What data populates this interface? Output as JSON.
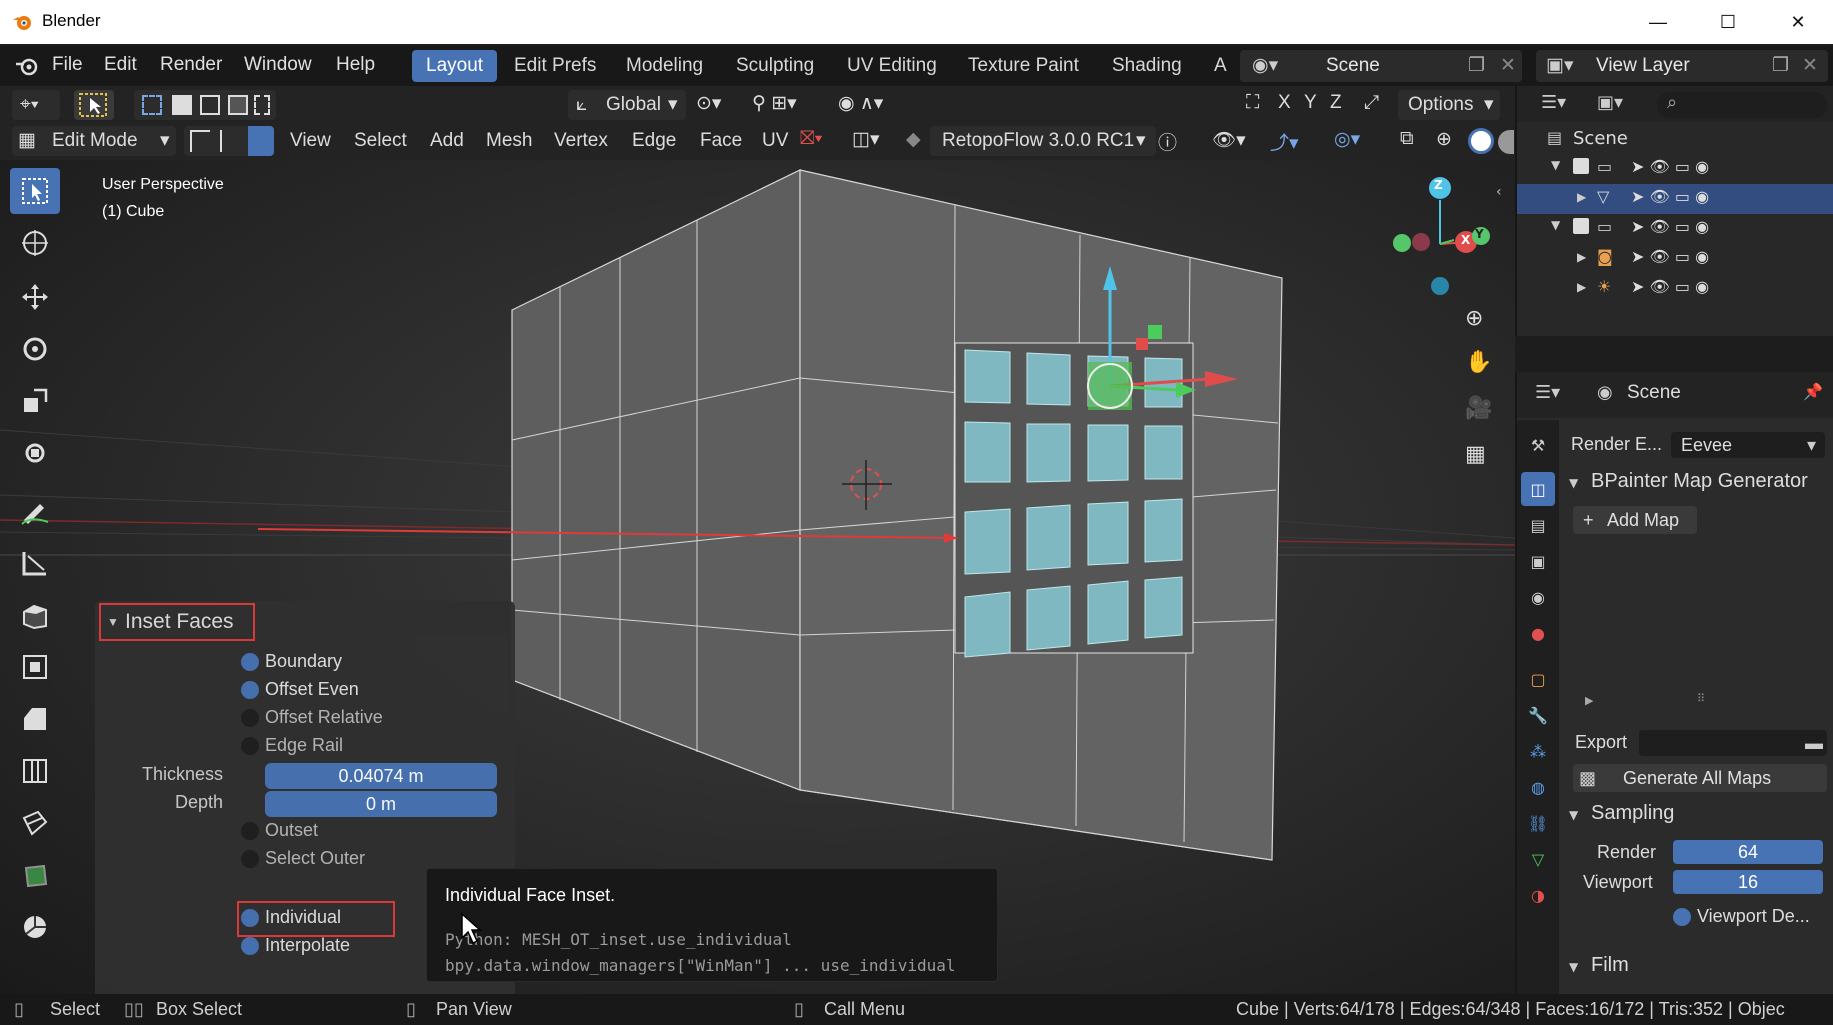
{
  "window": {
    "title": "Blender",
    "minimize": "—",
    "maximize": "☐",
    "close": "✕"
  },
  "menu": [
    "File",
    "Edit",
    "Render",
    "Window",
    "Help"
  ],
  "workspaces": {
    "active": "Layout",
    "tabs": [
      "Layout",
      "Edit Prefs",
      "Modeling",
      "Sculpting",
      "UV Editing",
      "Texture Paint",
      "Shading",
      "A"
    ]
  },
  "scene_field": "Scene",
  "view_layer_field": "View Layer",
  "header1": {
    "orientation": "Global",
    "options": "Options",
    "axes": [
      "X",
      "Y",
      "Z"
    ]
  },
  "header2": {
    "mode": "Edit Mode",
    "menus": [
      "View",
      "Select",
      "Add",
      "Mesh",
      "Vertex",
      "Edge",
      "Face",
      "UV"
    ],
    "addon": "RetopoFlow 3.0.0 RC1"
  },
  "viewport": {
    "perspective": "User Perspective",
    "object": "(1) Cube",
    "gizmo_axes": [
      "Z",
      "X",
      "Y"
    ]
  },
  "operator_panel": {
    "title": "Inset Faces",
    "options": [
      {
        "label": "Boundary",
        "checked": true
      },
      {
        "label": "Offset Even",
        "checked": true
      },
      {
        "label": "Offset Relative",
        "checked": false
      },
      {
        "label": "Edge Rail",
        "checked": false
      }
    ],
    "thickness_label": "Thickness",
    "thickness_value": "0.04074 m",
    "depth_label": "Depth",
    "depth_value": "0 m",
    "options2": [
      {
        "label": "Outset",
        "checked": false
      },
      {
        "label": "Select Outer",
        "checked": false
      },
      {
        "label": "Individual",
        "checked": true
      },
      {
        "label": "Interpolate",
        "checked": true
      }
    ]
  },
  "tooltip": {
    "title": "Individual Face Inset.",
    "python": "Python: MESH_OT_inset.use_individual",
    "path": "bpy.data.window_managers[\"WinMan\"] ... use_individual"
  },
  "outliner": {
    "root": "Scene"
  },
  "properties": {
    "header": "Scene",
    "render_engine_label": "Render E...",
    "render_engine_value": "Eevee",
    "panel_bpainter": "BPainter Map Generator",
    "add_map": "Add Map",
    "export_label": "Export",
    "generate_all": "Generate All Maps",
    "sampling": "Sampling",
    "render_label": "Render",
    "render_value": "64",
    "viewport_label": "Viewport",
    "viewport_value": "16",
    "viewport_denoise": "Viewport De...",
    "film": "Film"
  },
  "statusbar": {
    "select": "Select",
    "box_select": "Box Select",
    "pan_view": "Pan View",
    "call_menu": "Call Menu",
    "stats": "Cube | Verts:64/178 | Edges:64/348 | Faces:16/172 | Tris:352 | Objec"
  },
  "colors": {
    "accent": "#4772b3",
    "highlight_red": "#e03a3a",
    "selected_face": "#7fb8c0"
  }
}
